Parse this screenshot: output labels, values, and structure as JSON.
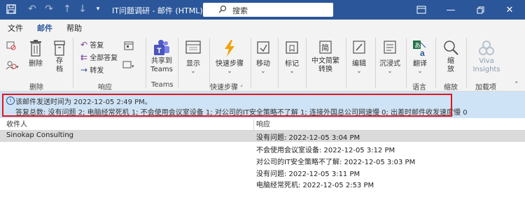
{
  "titlebar": {
    "title": "IT问题调研  -  邮件 (HTML)",
    "search_label": "搜索"
  },
  "tabs": [
    {
      "label": "文件",
      "active": false
    },
    {
      "label": "邮件",
      "active": true
    },
    {
      "label": "帮助",
      "active": false
    }
  ],
  "ribbon": {
    "delete": {
      "label": "删除",
      "archive": "存档",
      "group": "删除"
    },
    "respond": {
      "reply": "答复",
      "reply_all": "全部答复",
      "forward": "转发",
      "group": "响应"
    },
    "teams": {
      "share": "共享到 Teams",
      "group": "Teams"
    },
    "display": {
      "label": "显示"
    },
    "quick_steps": {
      "label": "快速步骤",
      "group": "快速步骤"
    },
    "move": {
      "label": "移动"
    },
    "tags": {
      "label": "标记"
    },
    "chinese_convert": {
      "label": "中文简繁 转换"
    },
    "edit": {
      "label": "编辑"
    },
    "immersive": {
      "label": "沉浸式"
    },
    "translate": {
      "label": "翻译",
      "group": "语言"
    },
    "zoom": {
      "label": "缩放",
      "group": "缩放"
    },
    "viva": {
      "label": "Viva Insights",
      "group": "加载项"
    }
  },
  "infobar": {
    "line1": "该邮件发送时间为 2022-12-05 2:49 PM。",
    "line2": "答复总数: 没有问题 2; 电脑经常死机 1; 不会使用会议室设备 1; 对公司的IT安全策略不了解 1; 连接外国总公司网速慢 0; 出差时邮件收发速度慢 0"
  },
  "table": {
    "headers": [
      "收件人",
      "响应"
    ],
    "rows": [
      {
        "recipient": "Sinokap Consulting",
        "response": "没有问题: 2022-12-05 3:04 PM",
        "selected": true
      },
      {
        "recipient": "",
        "response": "不会使用会议室设备: 2022-12-05 3:12 PM",
        "selected": false
      },
      {
        "recipient": "",
        "response": "对公司的IT安全策略不了解: 2022-12-05 3:03 PM",
        "selected": false
      },
      {
        "recipient": "",
        "response": "没有问题: 2022-12-05 3:11 PM",
        "selected": false
      },
      {
        "recipient": "",
        "response": "电脑经常死机: 2022-12-05 2:53 PM",
        "selected": false
      }
    ]
  },
  "colors": {
    "title_bar": "#2b579a",
    "ribbon_bg": "#f3f3f3",
    "info_bg": "#cfe3f6",
    "highlight_box": "#e0161c",
    "selected_row": "#dadada"
  }
}
